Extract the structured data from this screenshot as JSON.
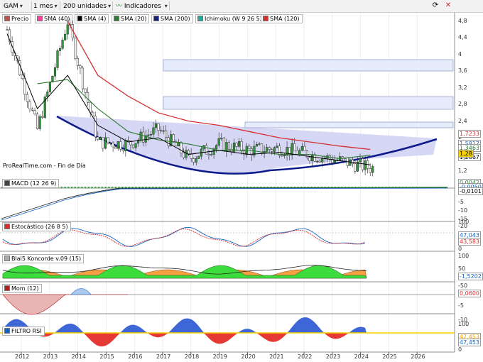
{
  "toolbar": {
    "symbol": "GAM",
    "period": "1 mes",
    "units": "200 unidades",
    "indicators": "Indicadores",
    "colors": {
      "bg": "#f2f2f2"
    }
  },
  "legend": [
    {
      "label": "Precio",
      "color": "#c0504d"
    },
    {
      "label": "SMA (40)",
      "color": "#ff3fa0"
    },
    {
      "label": "SMA (4)",
      "color": "#000000"
    },
    {
      "label": "SMA (20)",
      "color": "#2e7d32"
    },
    {
      "label": "SMA (200)",
      "color": "#1a237e"
    },
    {
      "label": "Ichimoku (W 9 26 52)",
      "color": "#26a69a"
    },
    {
      "label": "SMA (120)",
      "color": "#d32f2f"
    }
  ],
  "watermark": "ProRealTime.com - Fin de Día",
  "price_axis": [
    "4,8",
    "4,4",
    "4",
    "3,6",
    "3,2",
    "2,8",
    "2,4",
    "2",
    "1,6",
    "1,2"
  ],
  "price_tags": {
    "red": "1,7233",
    "blue": "1,5817",
    "green": "1,3463",
    "black": "1,2867",
    "price": "1,28"
  },
  "panes": {
    "macd": {
      "label": "MACD (12 26 9)",
      "axis": [
        "5",
        "0",
        "-5",
        "-10",
        "-15",
        "-20"
      ],
      "tags": [
        "0,0042",
        "-0,0050",
        "-0,0101"
      ]
    },
    "stoch": {
      "label": "Estocástico (26 8 5)",
      "axis": [
        "100",
        "50",
        "0"
      ],
      "tags": [
        "47,043",
        "43,583"
      ]
    },
    "blai5": {
      "label": "Blai5 Koncorde v.09 (15)",
      "axis": [
        "100",
        "50",
        "0",
        "-50"
      ],
      "tags": [
        "-1,5202"
      ]
    },
    "mom": {
      "label": "Mom (12)",
      "axis": [
        "0",
        "-5",
        "-10"
      ],
      "tags": [
        "0,0600"
      ]
    },
    "rsi": {
      "label": "FILTRO RSI",
      "axis": [
        "100",
        "50",
        "0"
      ],
      "tags": [
        "47,453",
        "47,453"
      ]
    }
  },
  "x_axis": [
    "2012",
    "2013",
    "2014",
    "2015",
    "2016",
    "2017",
    "2018",
    "2019",
    "2020",
    "2021",
    "2022",
    "2023",
    "2024",
    "2025",
    "2026"
  ],
  "chart_data": {
    "type": "candlestick",
    "x": [
      "2012",
      "2013",
      "2014",
      "2015",
      "2016",
      "2017",
      "2018",
      "2019",
      "2020",
      "2021",
      "2022",
      "2023",
      "2024"
    ],
    "close": [
      4.6,
      2.2,
      4.8,
      1.9,
      1.85,
      2.2,
      1.5,
      1.85,
      1.7,
      1.75,
      1.6,
      1.45,
      1.28
    ],
    "series": [
      {
        "name": "SMA (120)",
        "values": [
          null,
          null,
          4.8,
          3.5,
          3.0,
          2.6,
          2.4,
          2.3,
          2.15,
          2.0,
          1.9,
          1.8,
          1.72
        ]
      },
      {
        "name": "SMA (40)",
        "values": [
          null,
          3.3,
          3.4,
          2.7,
          2.15,
          1.95,
          1.85,
          1.7,
          1.7,
          1.6,
          1.6,
          1.5,
          1.58
        ]
      },
      {
        "name": "SMA (20)",
        "values": [
          4.5,
          2.7,
          3.5,
          2.3,
          1.9,
          2.0,
          1.6,
          1.7,
          1.6,
          1.65,
          1.55,
          1.45,
          1.35
        ]
      }
    ],
    "ylim": [
      1.0,
      4.9
    ]
  }
}
